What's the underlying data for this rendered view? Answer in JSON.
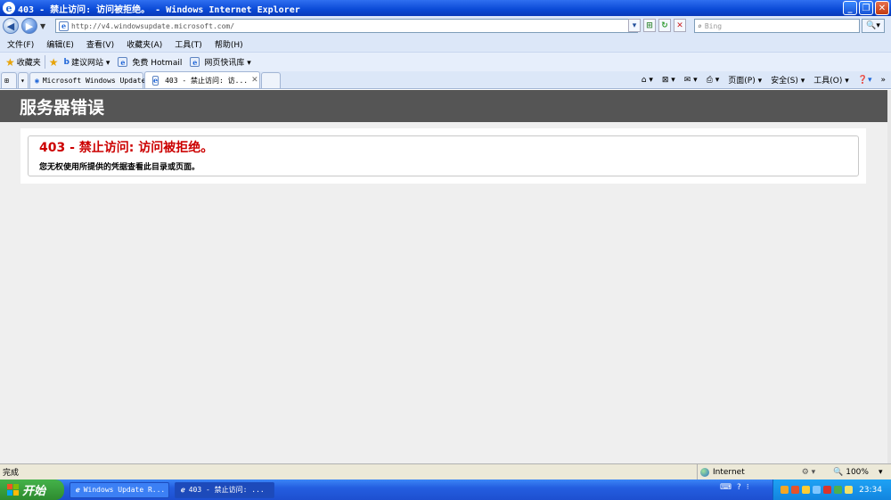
{
  "window": {
    "title": "403 - 禁止访问: 访问被拒绝。 - Windows Internet Explorer",
    "min_label": "_",
    "max_label": "❐",
    "close_label": "✕"
  },
  "address": {
    "url": "http://v4.windowsupdate.microsoft.com/",
    "search_placeholder": "Bing"
  },
  "menu": [
    "文件(F)",
    "编辑(E)",
    "查看(V)",
    "收藏夹(A)",
    "工具(T)",
    "帮助(H)"
  ],
  "favorites": {
    "label": "收藏夹",
    "items": [
      "建议网站 ▾",
      "免费 Hotmail",
      "网页快讯库 ▾"
    ]
  },
  "tabs": [
    {
      "label": "Microsoft Windows Update"
    },
    {
      "label": "403 - 禁止访问: 访..."
    }
  ],
  "command_bar": [
    "页面(P) ▾",
    "安全(S) ▾",
    "工具(O) ▾"
  ],
  "page": {
    "header": "服务器错误",
    "error_title": "403 - 禁止访问: 访问被拒绝。",
    "error_desc": "您无权使用所提供的凭据查看此目录或页面。"
  },
  "status": {
    "text": "完成",
    "zone": "Internet",
    "zoom": "100%"
  },
  "taskbar": {
    "start": "开始",
    "items": [
      "Windows Update R...",
      "403 - 禁止访问: ..."
    ],
    "clock": "23:34"
  }
}
